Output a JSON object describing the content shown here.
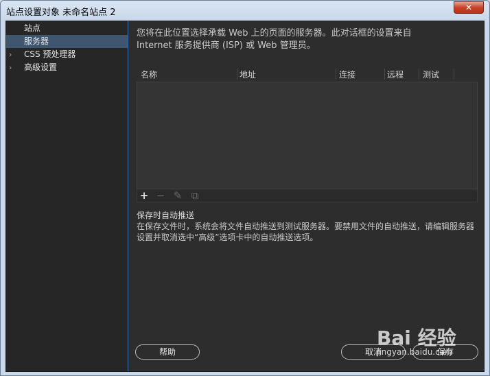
{
  "window": {
    "title": "站点设置对象 未命名站点 2",
    "close_glyph": "✕"
  },
  "sidebar": {
    "items": [
      {
        "label": "站点",
        "chevron": ""
      },
      {
        "label": "服务器",
        "chevron": "",
        "selected": true
      },
      {
        "label": "CSS 预处理器",
        "chevron": "›"
      },
      {
        "label": "高级设置",
        "chevron": "›"
      }
    ]
  },
  "main": {
    "intro_line1": "您将在此位置选择承载 Web 上的页面的服务器。此对话框的设置来自",
    "intro_line2": "Internet 服务提供商 (ISP) 或 Web 管理员。",
    "table": {
      "columns": [
        "名称",
        "地址",
        "连接",
        "远程",
        "测试"
      ],
      "rows": []
    },
    "toolbar": {
      "add": "+",
      "remove": "−",
      "edit": "✎",
      "duplicate": "⧉"
    },
    "autopush_title": "保存时自动推送",
    "autopush_desc": "在保存文件时，系统会将文件自动推送到测试服务器。要禁用文件的自动推送，请编辑服务器设置并取消选中“高级”选项卡中的自动推送选项。"
  },
  "buttons": {
    "help": "帮助",
    "cancel": "取消",
    "save": "保存"
  },
  "watermark": {
    "logo": "Bai 经验",
    "url": "jingyan.baidu.com"
  }
}
